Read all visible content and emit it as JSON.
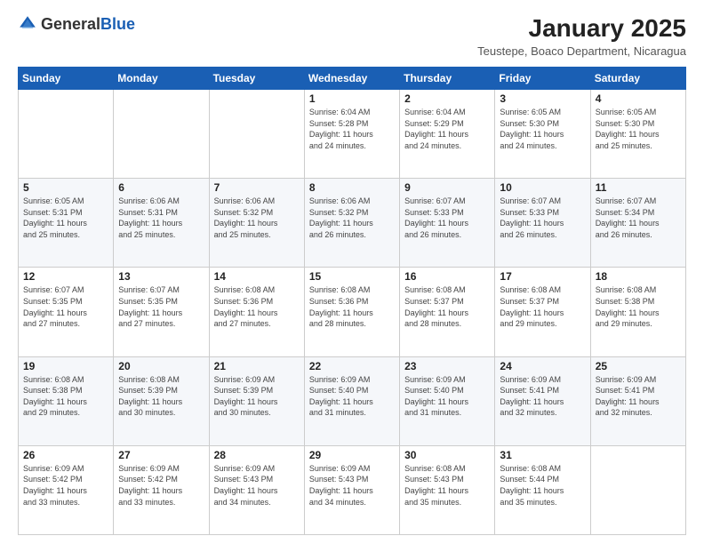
{
  "header": {
    "logo_general": "General",
    "logo_blue": "Blue",
    "month_year": "January 2025",
    "location": "Teustepe, Boaco Department, Nicaragua"
  },
  "weekdays": [
    "Sunday",
    "Monday",
    "Tuesday",
    "Wednesday",
    "Thursday",
    "Friday",
    "Saturday"
  ],
  "weeks": [
    [
      {
        "day": "",
        "info": ""
      },
      {
        "day": "",
        "info": ""
      },
      {
        "day": "",
        "info": ""
      },
      {
        "day": "1",
        "info": "Sunrise: 6:04 AM\nSunset: 5:28 PM\nDaylight: 11 hours\nand 24 minutes."
      },
      {
        "day": "2",
        "info": "Sunrise: 6:04 AM\nSunset: 5:29 PM\nDaylight: 11 hours\nand 24 minutes."
      },
      {
        "day": "3",
        "info": "Sunrise: 6:05 AM\nSunset: 5:30 PM\nDaylight: 11 hours\nand 24 minutes."
      },
      {
        "day": "4",
        "info": "Sunrise: 6:05 AM\nSunset: 5:30 PM\nDaylight: 11 hours\nand 25 minutes."
      }
    ],
    [
      {
        "day": "5",
        "info": "Sunrise: 6:05 AM\nSunset: 5:31 PM\nDaylight: 11 hours\nand 25 minutes."
      },
      {
        "day": "6",
        "info": "Sunrise: 6:06 AM\nSunset: 5:31 PM\nDaylight: 11 hours\nand 25 minutes."
      },
      {
        "day": "7",
        "info": "Sunrise: 6:06 AM\nSunset: 5:32 PM\nDaylight: 11 hours\nand 25 minutes."
      },
      {
        "day": "8",
        "info": "Sunrise: 6:06 AM\nSunset: 5:32 PM\nDaylight: 11 hours\nand 26 minutes."
      },
      {
        "day": "9",
        "info": "Sunrise: 6:07 AM\nSunset: 5:33 PM\nDaylight: 11 hours\nand 26 minutes."
      },
      {
        "day": "10",
        "info": "Sunrise: 6:07 AM\nSunset: 5:33 PM\nDaylight: 11 hours\nand 26 minutes."
      },
      {
        "day": "11",
        "info": "Sunrise: 6:07 AM\nSunset: 5:34 PM\nDaylight: 11 hours\nand 26 minutes."
      }
    ],
    [
      {
        "day": "12",
        "info": "Sunrise: 6:07 AM\nSunset: 5:35 PM\nDaylight: 11 hours\nand 27 minutes."
      },
      {
        "day": "13",
        "info": "Sunrise: 6:07 AM\nSunset: 5:35 PM\nDaylight: 11 hours\nand 27 minutes."
      },
      {
        "day": "14",
        "info": "Sunrise: 6:08 AM\nSunset: 5:36 PM\nDaylight: 11 hours\nand 27 minutes."
      },
      {
        "day": "15",
        "info": "Sunrise: 6:08 AM\nSunset: 5:36 PM\nDaylight: 11 hours\nand 28 minutes."
      },
      {
        "day": "16",
        "info": "Sunrise: 6:08 AM\nSunset: 5:37 PM\nDaylight: 11 hours\nand 28 minutes."
      },
      {
        "day": "17",
        "info": "Sunrise: 6:08 AM\nSunset: 5:37 PM\nDaylight: 11 hours\nand 29 minutes."
      },
      {
        "day": "18",
        "info": "Sunrise: 6:08 AM\nSunset: 5:38 PM\nDaylight: 11 hours\nand 29 minutes."
      }
    ],
    [
      {
        "day": "19",
        "info": "Sunrise: 6:08 AM\nSunset: 5:38 PM\nDaylight: 11 hours\nand 29 minutes."
      },
      {
        "day": "20",
        "info": "Sunrise: 6:08 AM\nSunset: 5:39 PM\nDaylight: 11 hours\nand 30 minutes."
      },
      {
        "day": "21",
        "info": "Sunrise: 6:09 AM\nSunset: 5:39 PM\nDaylight: 11 hours\nand 30 minutes."
      },
      {
        "day": "22",
        "info": "Sunrise: 6:09 AM\nSunset: 5:40 PM\nDaylight: 11 hours\nand 31 minutes."
      },
      {
        "day": "23",
        "info": "Sunrise: 6:09 AM\nSunset: 5:40 PM\nDaylight: 11 hours\nand 31 minutes."
      },
      {
        "day": "24",
        "info": "Sunrise: 6:09 AM\nSunset: 5:41 PM\nDaylight: 11 hours\nand 32 minutes."
      },
      {
        "day": "25",
        "info": "Sunrise: 6:09 AM\nSunset: 5:41 PM\nDaylight: 11 hours\nand 32 minutes."
      }
    ],
    [
      {
        "day": "26",
        "info": "Sunrise: 6:09 AM\nSunset: 5:42 PM\nDaylight: 11 hours\nand 33 minutes."
      },
      {
        "day": "27",
        "info": "Sunrise: 6:09 AM\nSunset: 5:42 PM\nDaylight: 11 hours\nand 33 minutes."
      },
      {
        "day": "28",
        "info": "Sunrise: 6:09 AM\nSunset: 5:43 PM\nDaylight: 11 hours\nand 34 minutes."
      },
      {
        "day": "29",
        "info": "Sunrise: 6:09 AM\nSunset: 5:43 PM\nDaylight: 11 hours\nand 34 minutes."
      },
      {
        "day": "30",
        "info": "Sunrise: 6:08 AM\nSunset: 5:43 PM\nDaylight: 11 hours\nand 35 minutes."
      },
      {
        "day": "31",
        "info": "Sunrise: 6:08 AM\nSunset: 5:44 PM\nDaylight: 11 hours\nand 35 minutes."
      },
      {
        "day": "",
        "info": ""
      }
    ]
  ]
}
